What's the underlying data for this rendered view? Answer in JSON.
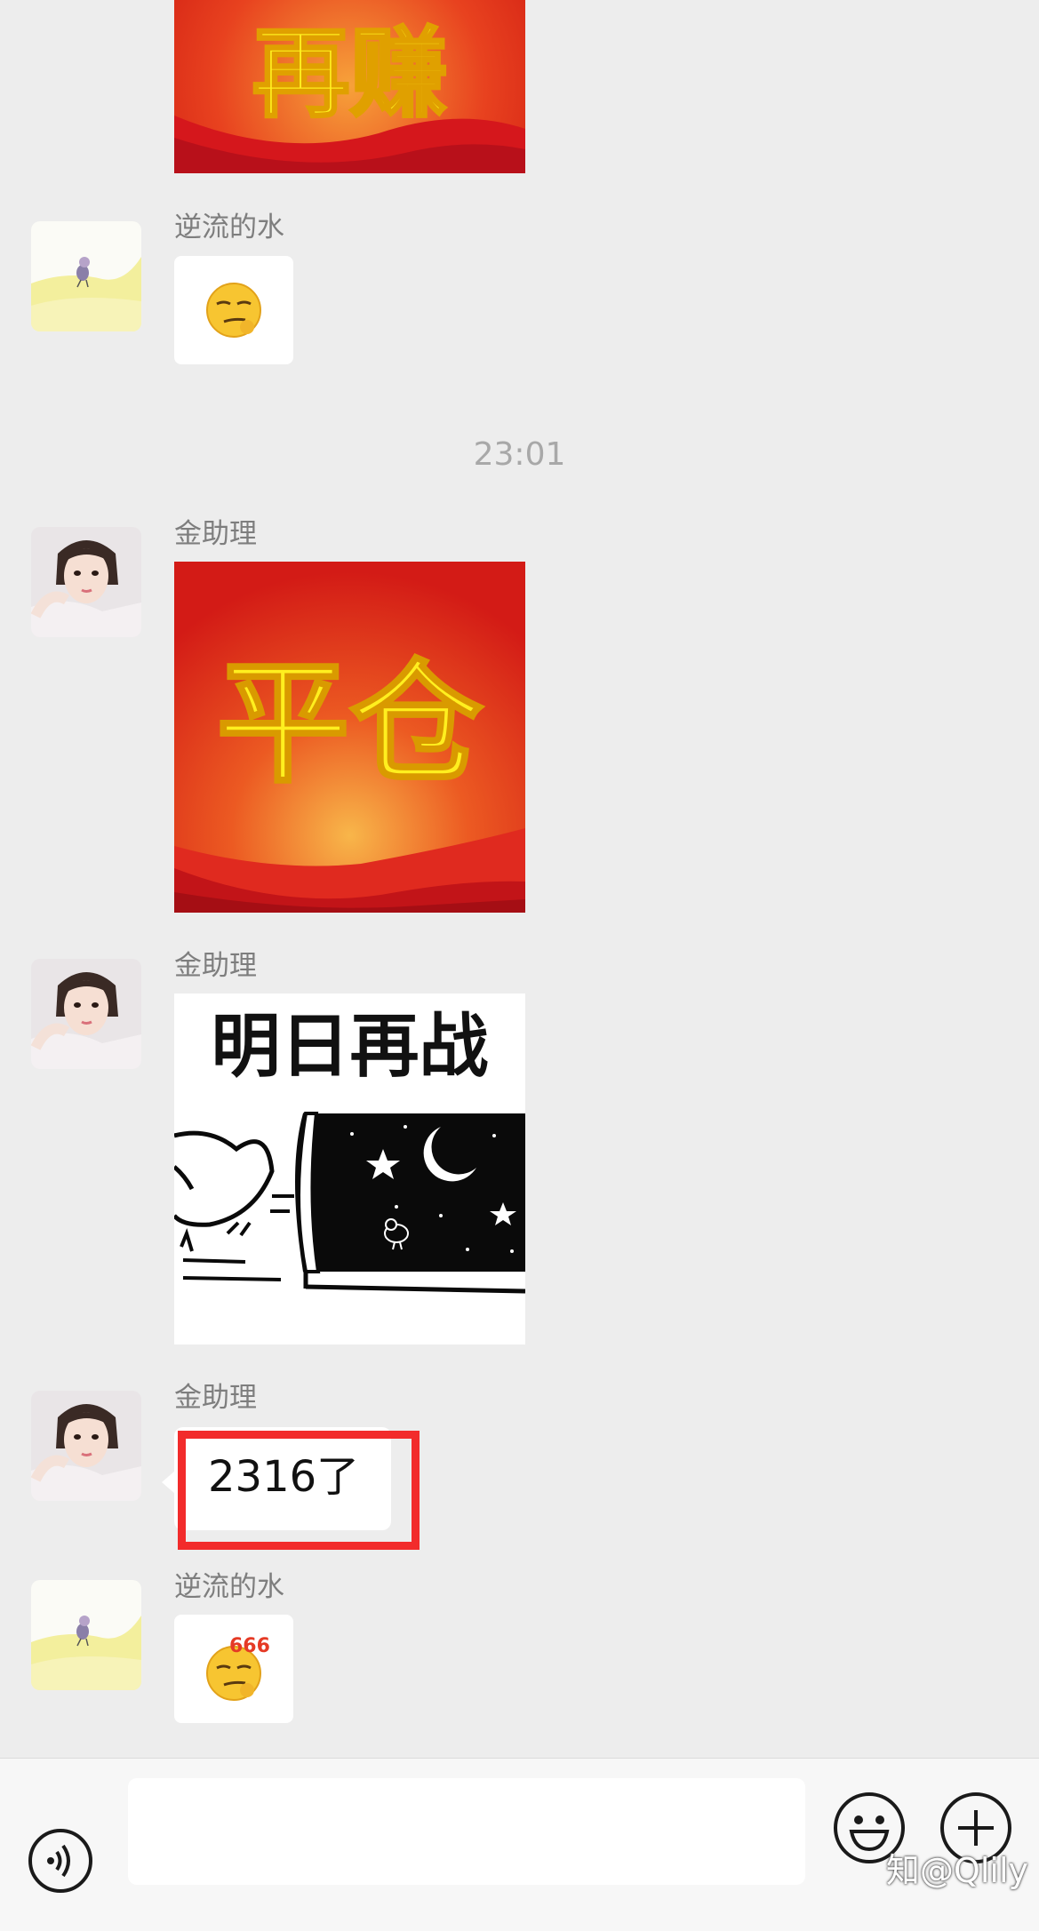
{
  "messages": [
    {
      "type": "sticker",
      "sender": "",
      "sticker_text": "再赚"
    },
    {
      "type": "emoji",
      "sender": "逆流的水",
      "emoji": "smirk-face"
    },
    {
      "type": "timestamp",
      "time": "23:01"
    },
    {
      "type": "sticker",
      "sender": "金助理",
      "sticker_text": "平仓"
    },
    {
      "type": "sticker",
      "sender": "金助理",
      "sticker_text": "明日再战"
    },
    {
      "type": "text",
      "sender": "金助理",
      "text": "2316了",
      "highlighted": true
    },
    {
      "type": "emoji",
      "sender": "逆流的水",
      "emoji": "smirk-face-666",
      "emoji_text": "666"
    }
  ],
  "input_bar": {
    "voice_icon": "voice-icon",
    "text_value": "",
    "emoji_icon": "emoji-icon",
    "plus_icon": "plus-icon"
  },
  "watermark": "@Qlily",
  "colors": {
    "background": "#ededed",
    "bubble": "#ffffff",
    "highlight": "#f22b2b",
    "sticker_red": "#e2231a",
    "sticker_yellow": "#ffef1f"
  }
}
